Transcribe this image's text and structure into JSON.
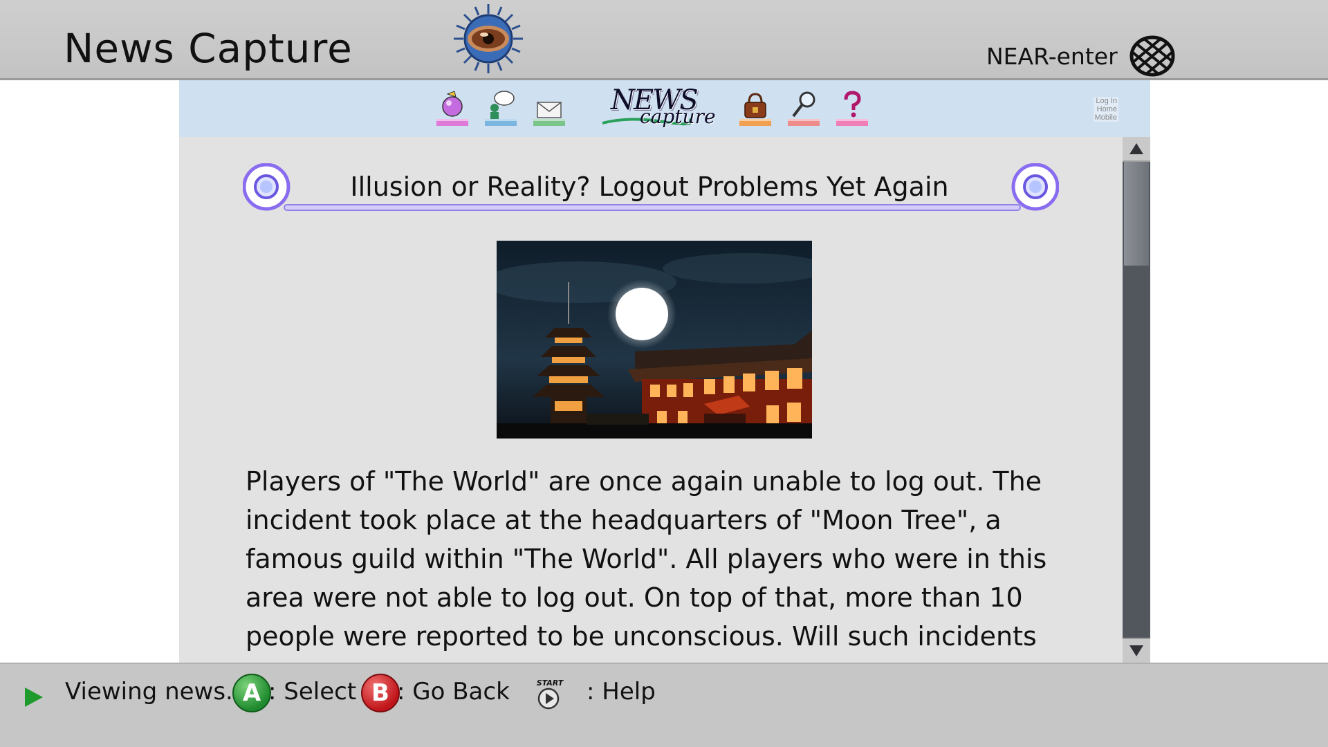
{
  "header": {
    "title": "News Capture",
    "network_label": "NEAR-enter"
  },
  "site": {
    "nav_icons": [
      "news-orb-icon",
      "chat-icon",
      "mail-icon",
      "shop-bag-icon",
      "search-icon",
      "help-icon"
    ],
    "logo_news": "NEWS",
    "logo_capture": "capture",
    "mini_links": [
      "Log In",
      "Home",
      "Mobile"
    ]
  },
  "article": {
    "headline": "Illusion or Reality? Logout Problems Yet Again",
    "body": "Players of \"The World\" are once again unable to log out. The\nincident took place at the headquarters of \"Moon Tree\", a\nfamous guild within \"The World\". All players who were in this\narea were not able to log out. On top of that, more than 10\npeople were reported to be unconscious. Will such incidents"
  },
  "footer": {
    "status": "Viewing news.",
    "a_button": "A",
    "a_action": ": Select",
    "b_button": "B",
    "b_action": ": Go Back",
    "start_label": "START",
    "help_action": ": Help"
  },
  "colors": {
    "header_bg": "#c8c8c8",
    "nav_bg": "#cfe0f1",
    "content_bg": "#e2e2e2",
    "accent_ring": "#8a6cf0",
    "button_a": "#1f8a2e",
    "button_b": "#c0151a"
  }
}
